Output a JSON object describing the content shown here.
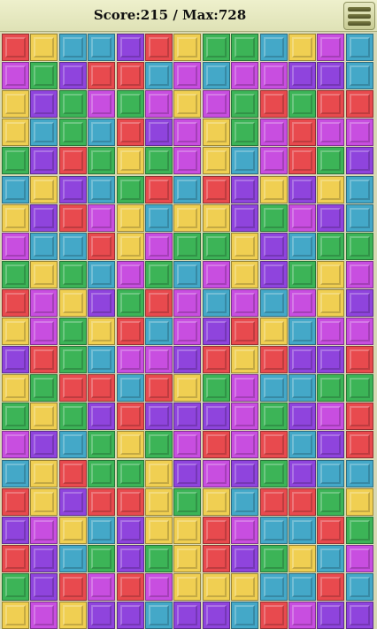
{
  "header": {
    "score_text": "Score:215 / Max:728"
  },
  "colors": {
    "R": "#e84a4e",
    "Y": "#f0cf52",
    "C": "#44a8c8",
    "P": "#8f44dd",
    "M": "#c84ee0",
    "G": "#3cb457"
  },
  "board": {
    "columns": 13,
    "rows": 21,
    "grid": [
      "RYCCPRYGGCYMC",
      "MGPRRCMCMMPPC",
      "YPGMGMYMGRGRR",
      "YCGCRPMYGMRMM",
      "GPRGYGMYCMRGP",
      "CYPCGRCRPYPYC",
      "YPRMYCYYPGMPC",
      "MCCRYMGGYPCGG",
      "GYGCMGCMYPGYM",
      "RMYPGRMCMCMYP",
      "YMGYRCMPRYCMM",
      "PRGCMMPRYRPPR",
      "YGRRCRYGMCCGG",
      "GYGPRPPPMGPMR",
      "MPCGYGMRMRCPR",
      "CYRGGYPMPGPCC",
      "RYPRRYGYCRRGY",
      "PMYCPYYRMCCRG",
      "RPCGPGYRPGYCM",
      "GPRMRMYYYCCRC",
      "YMYPPCPPCRMPP"
    ]
  }
}
